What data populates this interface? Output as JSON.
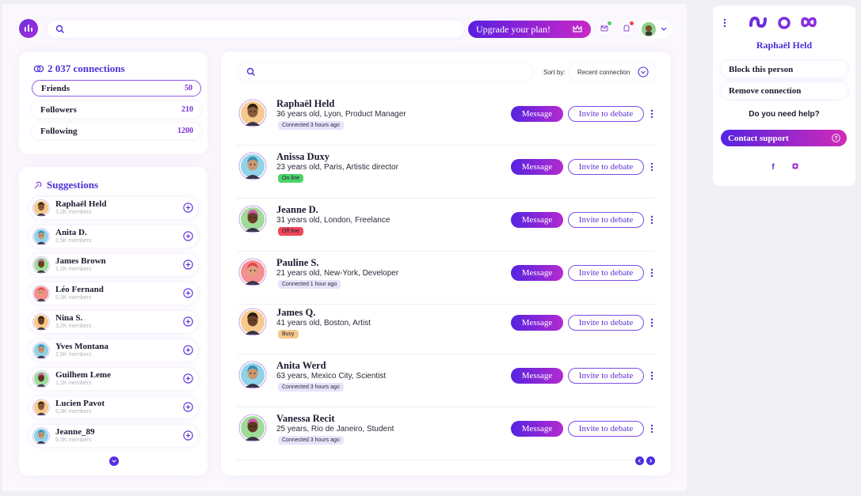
{
  "header": {
    "upgrade_label": "Upgrade your plan!",
    "search_placeholder": ""
  },
  "connections": {
    "title": "2 037 connections",
    "rows": [
      {
        "label": "Friends",
        "count": "50"
      },
      {
        "label": "Followers",
        "count": "210"
      },
      {
        "label": "Following",
        "count": "1200"
      }
    ]
  },
  "suggestions": {
    "title": "Suggestions",
    "items": [
      {
        "name": "Raphaël Held",
        "members": "3,2K members"
      },
      {
        "name": "Anita D.",
        "members": "2,5K members"
      },
      {
        "name": "James Brown",
        "members": "1,2K members"
      },
      {
        "name": "Léo Fernand",
        "members": "5,3K members"
      },
      {
        "name": "Nina S.",
        "members": "3,2K members"
      },
      {
        "name": "Yves Montana",
        "members": "2,5K members"
      },
      {
        "name": "Guilhem Leme",
        "members": "1,2K members"
      },
      {
        "name": "Lucien Pavot",
        "members": "5,3K members"
      },
      {
        "name": "Jeanne_89",
        "members": "5,3K members"
      }
    ]
  },
  "main": {
    "sort_label": "Sort by:",
    "sort_value": "Recent connection",
    "message_label": "Message",
    "debate_label": "Invite to debate",
    "people": [
      {
        "name": "Raphaël Held",
        "desc": "36 years old, Lyon, Product Manager",
        "status": "Connected 3 hours ago"
      },
      {
        "name": "Anissa Duxy",
        "desc": "23 years old, Paris, Artistic director",
        "status": "On line"
      },
      {
        "name": "Jeanne D.",
        "desc": "31 years old, London, Freelance",
        "status": "Off line"
      },
      {
        "name": "Pauline S.",
        "desc": "21 years old, New-York, Developer",
        "status": "Connected 1 hour ago"
      },
      {
        "name": "James Q.",
        "desc": "41 years old, Boston, Artist",
        "status": "Busy"
      },
      {
        "name": "Anita Werd",
        "desc": "63 years, Mexico City, Scientist",
        "status": "Connected 3 hours ago"
      },
      {
        "name": "Vanessa Recit",
        "desc": "25 years, Rio de Janeiro, Student",
        "status": "Connected 3 hours ago"
      }
    ]
  },
  "side_panel": {
    "name": "Raphaël Held",
    "block_label": "Block this person",
    "remove_label": "Remove connection",
    "help_label": "Do you need help?",
    "support_label": "Contact support"
  },
  "colors": {
    "accent": "#4b2fd8",
    "gradient_start": "#5524e0",
    "gradient_end": "#c828c8",
    "online": "#4cd36a",
    "offline": "#f0475a",
    "busy": "#f5c98a",
    "connected": "#e6e4fb"
  }
}
